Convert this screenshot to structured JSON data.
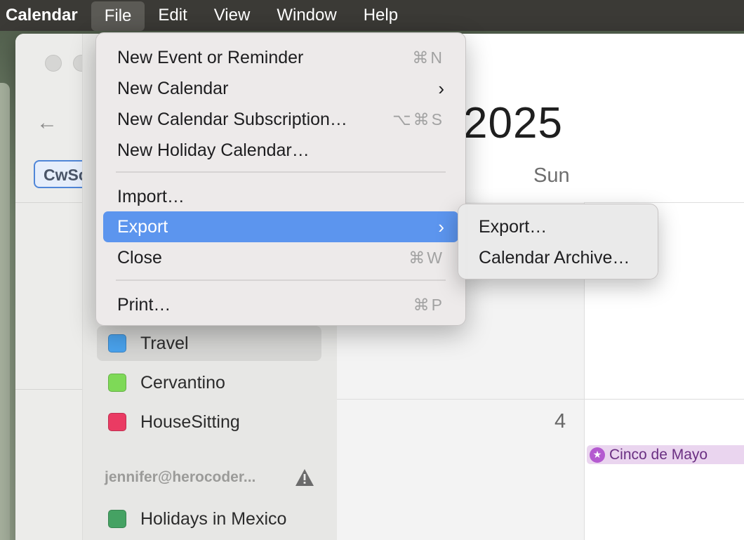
{
  "menubar": {
    "items": [
      "Calendar",
      "File",
      "Edit",
      "View",
      "Window",
      "Help"
    ],
    "active": "File"
  },
  "sidebar": {
    "cw_tag": "CwSc",
    "calendars": [
      {
        "name": "Travel",
        "color": "#4aa3ee",
        "selected": true
      },
      {
        "name": "Cervantino",
        "color": "#7ed957",
        "selected": false
      },
      {
        "name": "HouseSitting",
        "color": "#ea3b63",
        "selected": false
      }
    ],
    "account": {
      "label": "jennifer@herocoder...",
      "icon": "warning-icon"
    },
    "holiday_calendars": [
      {
        "name": "Holidays in Mexico",
        "color": "#45a263"
      }
    ]
  },
  "calendar": {
    "year": "2025",
    "day_of_week": "Sun",
    "day_number": "4",
    "event": {
      "title": "Cinco de Mayo",
      "icon": "star-icon",
      "color": "#b45ad0"
    }
  },
  "file_menu": {
    "items": [
      {
        "label": "New Event or Reminder",
        "shortcut": "⌘N"
      },
      {
        "label": "New Calendar",
        "submenu": true
      },
      {
        "label": "New Calendar Subscription…",
        "shortcut": "⌥⌘S"
      },
      {
        "label": "New Holiday Calendar…"
      },
      {
        "label": "Import…"
      },
      {
        "label": "Export",
        "submenu": true,
        "highlighted": true
      },
      {
        "label": "Close",
        "shortcut": "⌘W"
      },
      {
        "label": "Print…",
        "shortcut": "⌘P"
      }
    ]
  },
  "export_submenu": {
    "items": [
      "Export…",
      "Calendar Archive…"
    ]
  },
  "colors": {
    "highlight": "#5c95ee",
    "menubar": "#3b3a36"
  }
}
